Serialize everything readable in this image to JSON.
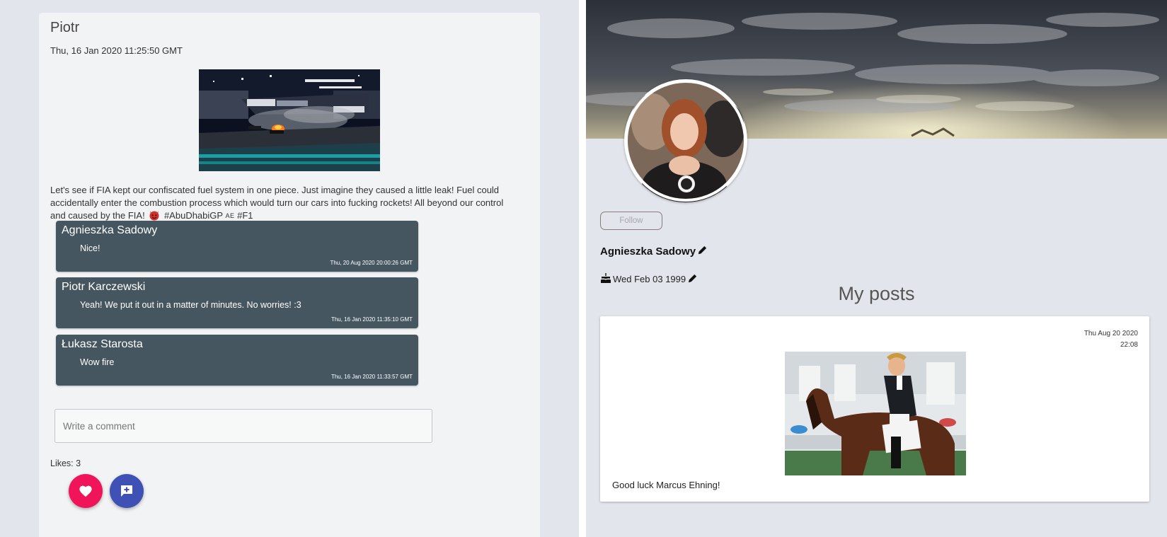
{
  "left_post": {
    "author": "Piotr",
    "date": "Thu, 16 Jan 2020 11:25:50 GMT",
    "text_main": "Let's see if FIA kept our confiscated fuel system in one piece. Just imagine they caused a little leak! Fuel could accidentally enter the combustion process which would turn our cars into fucking rockets! All beyond our control and caused by the FIA!",
    "hashtag_1": "#AbuDhabiGP",
    "flag_text": "AE",
    "hashtag_2": "#F1",
    "comments": [
      {
        "author": "Agnieszka Sadowy",
        "text": "Nice!",
        "date": "Thu, 20 Aug 2020 20:00:26 GMT"
      },
      {
        "author": "Piotr Karczewski",
        "text": "Yeah! We put it out in a matter of minutes. No worries! :3",
        "date": "Thu, 16 Jan 2020 11:35:10 GMT"
      },
      {
        "author": "Łukasz Starosta",
        "text": "Wow fire",
        "date": "Thu, 16 Jan 2020 11:33:57 GMT"
      }
    ],
    "comment_input_placeholder": "Write a comment",
    "likes_label": "Likes:",
    "likes_count": "3",
    "like_icon": "heart-icon",
    "comment_icon": "add-comment-icon"
  },
  "profile": {
    "follow_label": "Follow",
    "name": "Agnieszka Sadowy",
    "edit_icon": "pencil-icon",
    "birthday_icon": "cake-icon",
    "birthday": "Wed Feb 03 1999",
    "section_title": "My posts",
    "post": {
      "date_line1": "Thu Aug 20 2020",
      "date_line2": "22:08",
      "caption": "Good luck Marcus Ehning!"
    }
  },
  "colors": {
    "background": "#e3e5ec",
    "card": "#f2f3f4",
    "comment_bg": "#455660",
    "like_fab": "#f0145a",
    "comment_fab": "#3f51b5"
  }
}
